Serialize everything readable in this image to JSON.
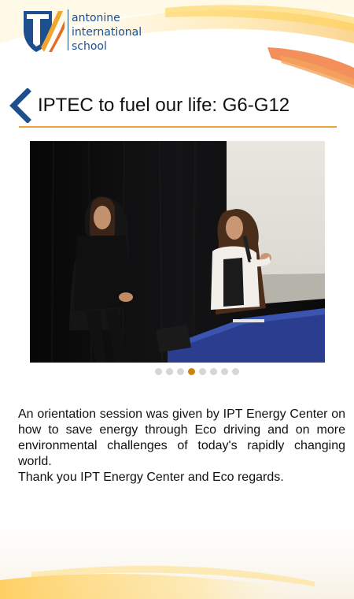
{
  "brand": {
    "line1": "antonine",
    "line2": "international",
    "line3": "school",
    "logo_letter": "T",
    "primary_color": "#1d4f8f",
    "accent_color": "#f0a531"
  },
  "page": {
    "back_icon": "chevron-left-icon",
    "title": "IPTEC to fuel our life: G6-G12"
  },
  "gallery": {
    "dot_count": 8,
    "active_index": 3
  },
  "content": {
    "paragraph": "An orientation session was given by IPT Energy Center on how to save energy through Eco driving and on more environmental challenges of today's rapidly changing world.",
    "thanks": "Thank you IPT Energy Center and Eco regards."
  }
}
